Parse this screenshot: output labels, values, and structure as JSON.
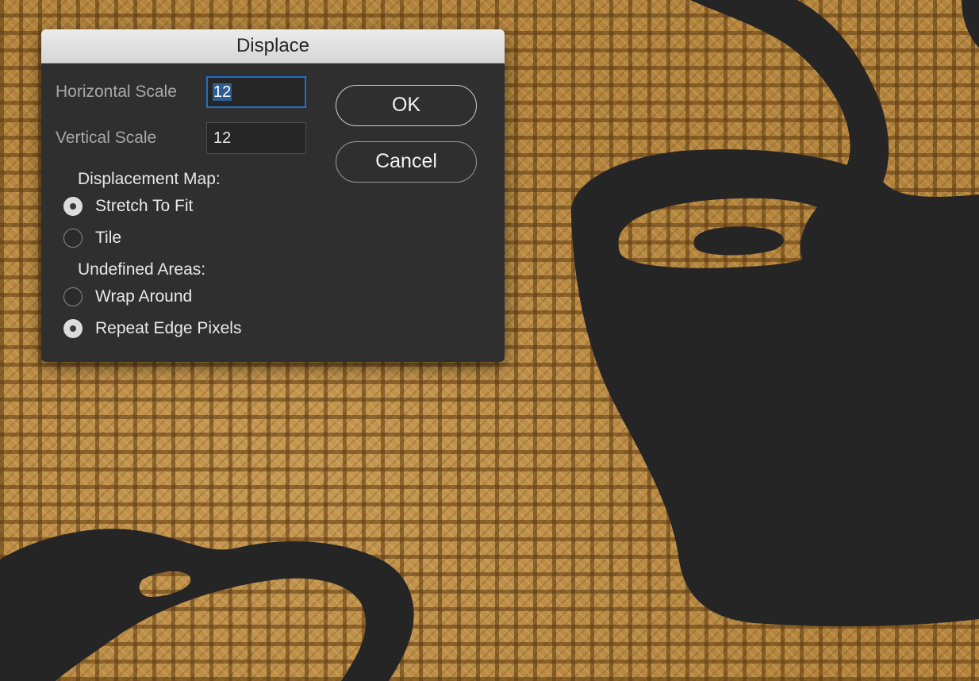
{
  "dialog": {
    "title": "Displace",
    "horizontal_scale": {
      "label": "Horizontal Scale",
      "value": "12"
    },
    "vertical_scale": {
      "label": "Vertical Scale",
      "value": "12"
    },
    "buttons": {
      "ok": "OK",
      "cancel": "Cancel"
    },
    "displacement_map": {
      "heading": "Displacement Map:",
      "options": [
        {
          "label": "Stretch To Fit",
          "selected": true
        },
        {
          "label": "Tile",
          "selected": false
        }
      ]
    },
    "undefined_areas": {
      "heading": "Undefined Areas:",
      "options": [
        {
          "label": "Wrap Around",
          "selected": false
        },
        {
          "label": "Repeat Edge Pixels",
          "selected": true
        }
      ]
    }
  },
  "canvas": {
    "texture": "burlap",
    "artwork": "coffee-cup-logo",
    "colors": {
      "artwork_fill": "#262526",
      "burlap_base": "#b3843d",
      "focus_ring": "#1f6fc4"
    }
  }
}
